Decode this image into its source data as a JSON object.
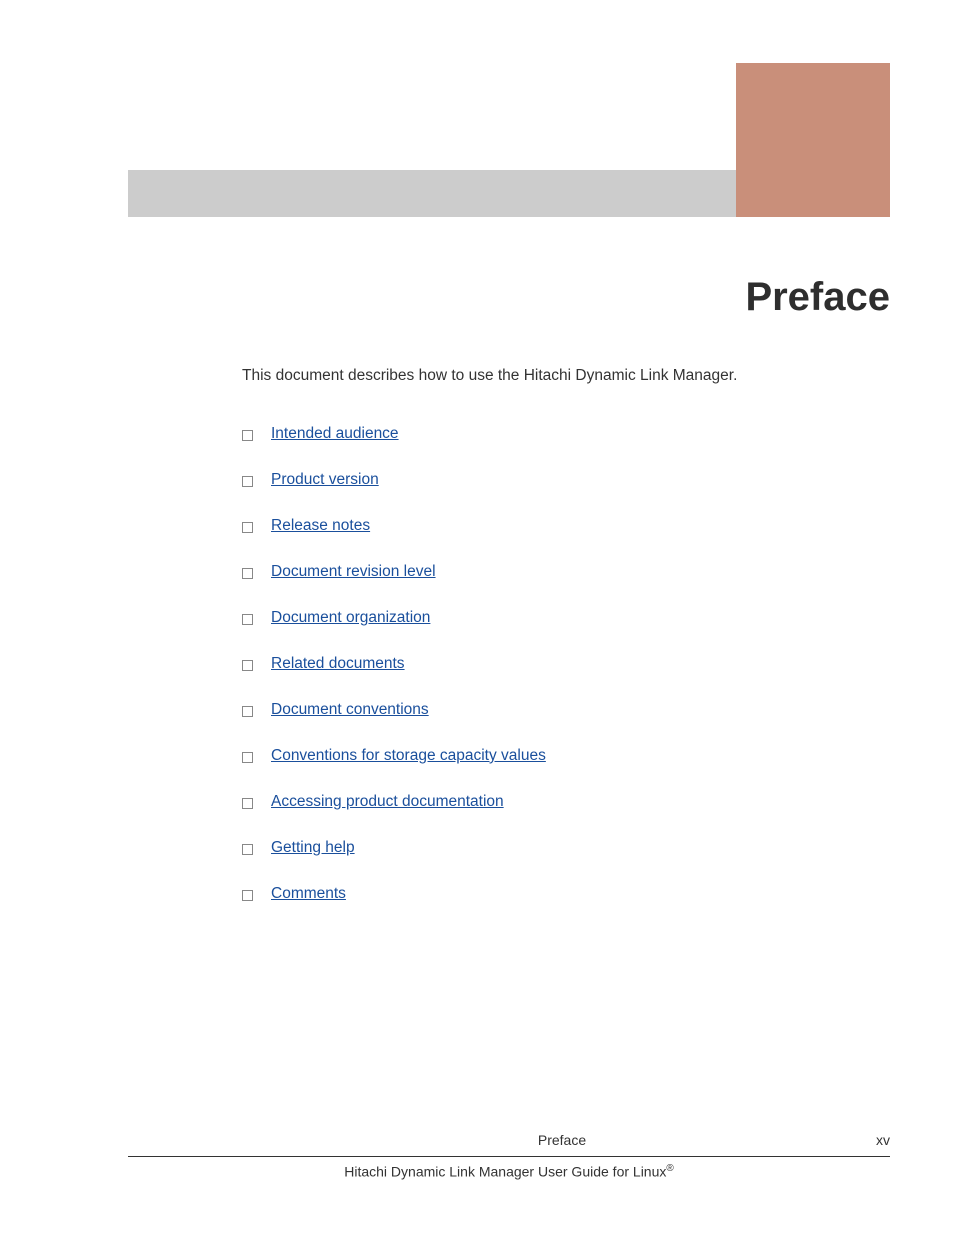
{
  "title": "Preface",
  "intro": "This document describes how to use the Hitachi Dynamic Link Manager.",
  "toc": [
    "Intended audience",
    "Product version",
    "Release notes",
    "Document revision level",
    "Document organization",
    "Related documents",
    "Document conventions",
    "Conventions for storage capacity values",
    "Accessing product documentation",
    "Getting help",
    "Comments"
  ],
  "footer": {
    "section": "Preface",
    "page": "xv",
    "book_prefix": "Hitachi Dynamic Link Manager User Guide for Linux",
    "reg": "®"
  }
}
